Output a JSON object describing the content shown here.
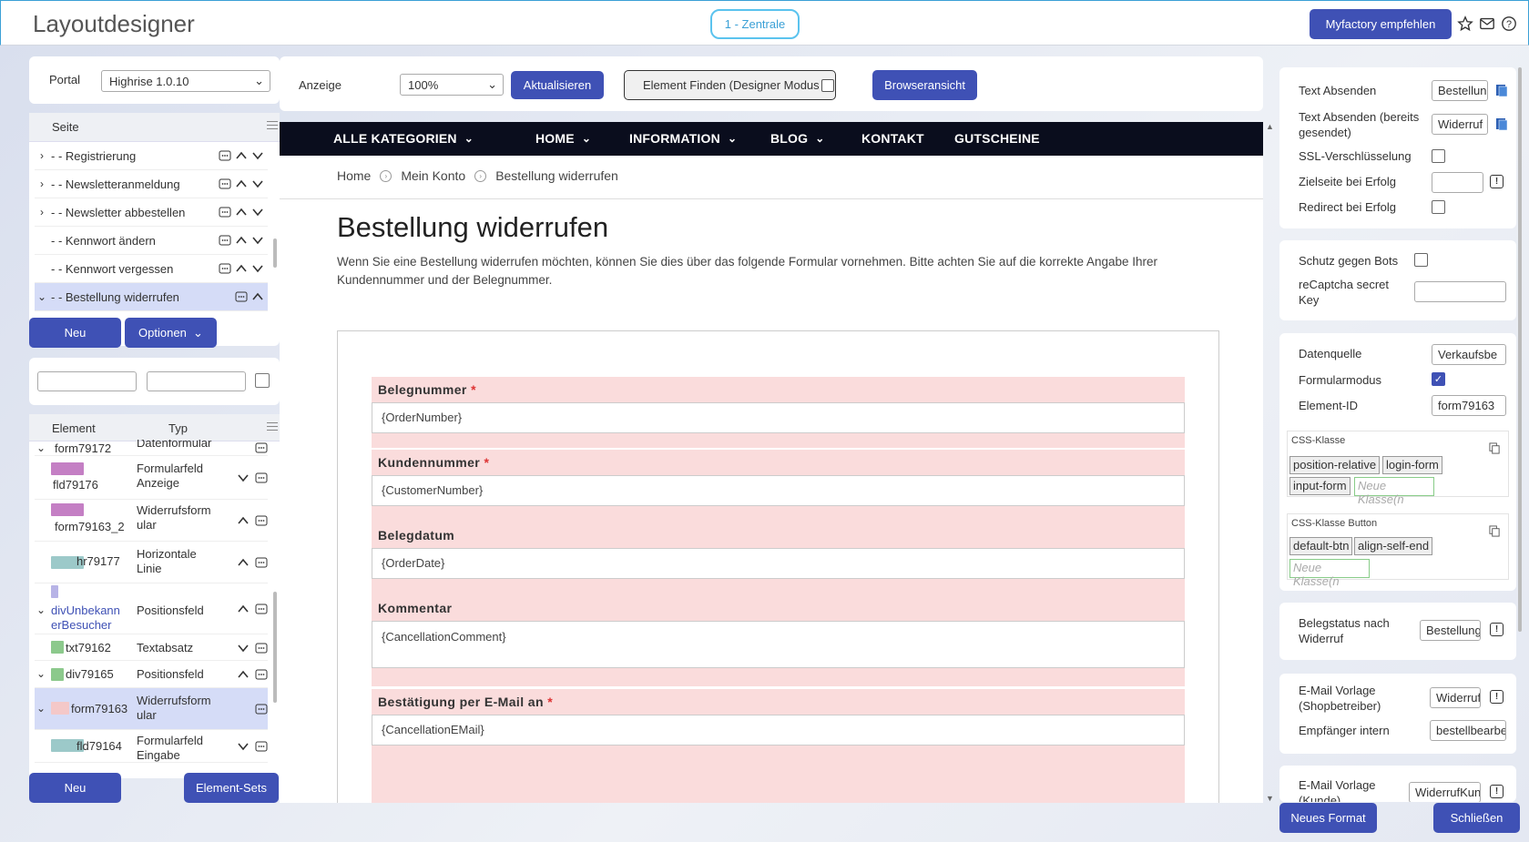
{
  "app": {
    "title": "Layoutdesigner",
    "context": "1 - Zentrale",
    "recommend": "Myfactory empfehlen"
  },
  "portal": {
    "label": "Portal",
    "value": "Highrise 1.0.10"
  },
  "seite": {
    "header": "Seite",
    "items": [
      {
        "label": "- - Registrierung",
        "expand": ">"
      },
      {
        "label": "- - Newsletteranmeldung",
        "expand": ">"
      },
      {
        "label": "- - Newsletter abbestellen",
        "expand": ">"
      },
      {
        "label": "- - Kennwort ändern",
        "expand": ""
      },
      {
        "label": "- - Kennwort vergessen",
        "expand": ""
      },
      {
        "label": "- - Bestellung widerrufen",
        "expand": "v"
      }
    ],
    "new_label": "Neu",
    "options_label": "Optionen"
  },
  "elements": {
    "col_element": "Element",
    "col_type": "Typ",
    "rows": [
      {
        "name": "form79172",
        "type": "Datenformular"
      },
      {
        "name": "fld79176",
        "type": "Formularfeld Anzeige"
      },
      {
        "name": "form79163_2",
        "type": "Widerrufsform ular"
      },
      {
        "name": "hr79177",
        "type": "Horizontale Linie"
      },
      {
        "name": "divUnbekann erBesucher",
        "type": "Positionsfeld"
      },
      {
        "name": "txt79162",
        "type": "Textabsatz"
      },
      {
        "name": "div79165",
        "type": "Positionsfeld"
      },
      {
        "name": "form79163",
        "type": "Widerrufsform ular"
      },
      {
        "name": "fld79164",
        "type": "Formularfeld Eingabe"
      }
    ],
    "new_label": "Neu",
    "sets_label": "Element-Sets"
  },
  "toolbar": {
    "zoom_label": "Anzeige",
    "zoom_value": "100%",
    "refresh": "Aktualisieren",
    "find": "Element Finden (Designer Modus",
    "browser": "Browseransicht"
  },
  "preview": {
    "nav": [
      "ALLE KATEGORIEN",
      "HOME",
      "INFORMATION",
      "BLOG",
      "KONTAKT",
      "GUTSCHEINE"
    ],
    "breadcrumb": [
      "Home",
      "Mein Konto",
      "Bestellung widerrufen"
    ],
    "heading": "Bestellung widerrufen",
    "intro": "Wenn Sie eine Bestellung widerrufen möchten, können Sie dies über das folgende Formular vornehmen. Bitte achten Sie auf die korrekte Angabe Ihrer Kundennummer und der Belegnummer.",
    "fields": [
      {
        "label": "Belegnummer",
        "required": "*",
        "value": "{OrderNumber}"
      },
      {
        "label": "Kundennummer",
        "required": "*",
        "value": "{CustomerNumber}"
      },
      {
        "label": "Belegdatum",
        "required": "",
        "value": "{OrderDate}"
      },
      {
        "label": "Kommentar",
        "required": "",
        "value": "{CancellationComment}"
      },
      {
        "label": "Bestätigung per E-Mail an",
        "required": "*",
        "value": "{CancellationEMail}"
      }
    ]
  },
  "props": {
    "text_absenden_label": "Text Absenden",
    "text_absenden_value": "Bestellung",
    "text_sent_label": "Text Absenden (bereits gesendet)",
    "text_sent_value": "Widerruf I",
    "ssl_label": "SSL-Verschlüsselung",
    "target_label": "Zielseite bei Erfolg",
    "target_value": "",
    "redirect_label": "Redirect bei Erfolg",
    "bot_label": "Schutz gegen Bots",
    "recaptcha_label": "reCaptcha secret Key",
    "recaptcha_value": "",
    "source_label": "Datenquelle",
    "source_value": "Verkaufsbe",
    "form_mode_label": "Formularmodus",
    "element_id_label": "Element-ID",
    "element_id_value": "form79163",
    "css_class_title": "CSS-Klasse",
    "css_classes": [
      "position-relative",
      "login-form",
      "input-form"
    ],
    "css_new_placeholder": "Neue Klasse(n",
    "css_btn_title": "CSS-Klasse Button",
    "css_btn_classes": [
      "default-btn",
      "align-self-end"
    ],
    "status_label": "Belegstatus nach Widerruf",
    "status_value": "Bestellung",
    "mail_shop_label": "E-Mail Vorlage (Shopbetreiber)",
    "mail_shop_value": "Widerruf",
    "recipient_label": "Empfänger intern",
    "recipient_value": "bestellbearbe",
    "mail_customer_label": "E-Mail Vorlage (Kunde)",
    "mail_customer_value": "WiderrufKun"
  },
  "footer": {
    "new_format": "Neues Format",
    "close": "Schließen"
  },
  "colors": {
    "primary": "#3f51b5",
    "nav": "#0a0d1d",
    "field_bg": "#fadcdc",
    "selection": "#d5dcf7"
  }
}
